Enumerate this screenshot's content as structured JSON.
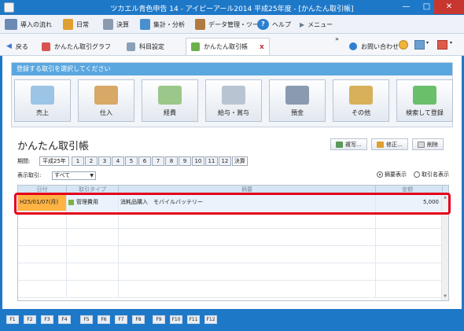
{
  "window": {
    "title": "ツカエル青色申告 14 - アイピーアール2014 平成25年度 - [かんたん取引帳]"
  },
  "menu": {
    "items": [
      {
        "label": "導入の流れ",
        "icon": "intro-icon"
      },
      {
        "label": "日常",
        "icon": "daily-icon"
      },
      {
        "label": "決算",
        "icon": "settlement-icon"
      },
      {
        "label": "集計・分析",
        "icon": "analysis-icon"
      },
      {
        "label": "データ管理・ツール",
        "icon": "data-tools-icon"
      },
      {
        "label": "ヘルプ",
        "icon": "help-icon"
      },
      {
        "label": "メニュー",
        "icon": "menu-icon"
      }
    ]
  },
  "tabs": {
    "back_label": "戻る",
    "items": [
      {
        "label": "かんたん取引グラフ"
      },
      {
        "label": "科目設定"
      },
      {
        "label": "かんたん取引帳"
      }
    ],
    "close_symbol": "x",
    "inquiry_label": "お問い合わせ",
    "overflow_symbol": "»"
  },
  "transaction_select": {
    "header": "登録する取引を選択してください",
    "tiles": [
      {
        "label": "売上",
        "icon": "sales-icon"
      },
      {
        "label": "仕入",
        "icon": "purchase-icon"
      },
      {
        "label": "経費",
        "icon": "expense-icon"
      },
      {
        "label": "給与・賞与",
        "icon": "salary-icon"
      },
      {
        "label": "預金",
        "icon": "deposit-icon"
      },
      {
        "label": "その他",
        "icon": "other-icon"
      },
      {
        "label": "検索して登録",
        "icon": "search-register-icon"
      }
    ]
  },
  "ledger": {
    "title": "かんたん取引帳",
    "buttons": {
      "copy": "複写...",
      "edit": "修正...",
      "delete": "削除"
    },
    "period_label": "期間:",
    "period_year": "平成25年",
    "months": [
      "1",
      "2",
      "3",
      "4",
      "5",
      "6",
      "7",
      "8",
      "9",
      "10",
      "11",
      "12",
      "決算"
    ],
    "display_label": "表示取引:",
    "display_value": "すべて",
    "radio_summary": "摘要表示",
    "radio_name": "取引名表示",
    "columns": {
      "date": "日付",
      "type": "取引タイプ",
      "desc": "摘要",
      "amount": "金額"
    },
    "rows": [
      {
        "date": "H25/01/07(月)",
        "type": "管理費用",
        "desc": "消耗品購入　モバイルバッテリー",
        "amount": "5,000"
      }
    ]
  },
  "fkeys": [
    "F1",
    "F2",
    "F3",
    "F4",
    "F5",
    "F6",
    "F7",
    "F8",
    "F9",
    "F10",
    "F11",
    "F12"
  ],
  "colors": {
    "title_blue": "#1e78c8",
    "header_blue": "#5aa7df",
    "date_highlight": "#ffb343",
    "annotation_red": "#e3001b"
  }
}
